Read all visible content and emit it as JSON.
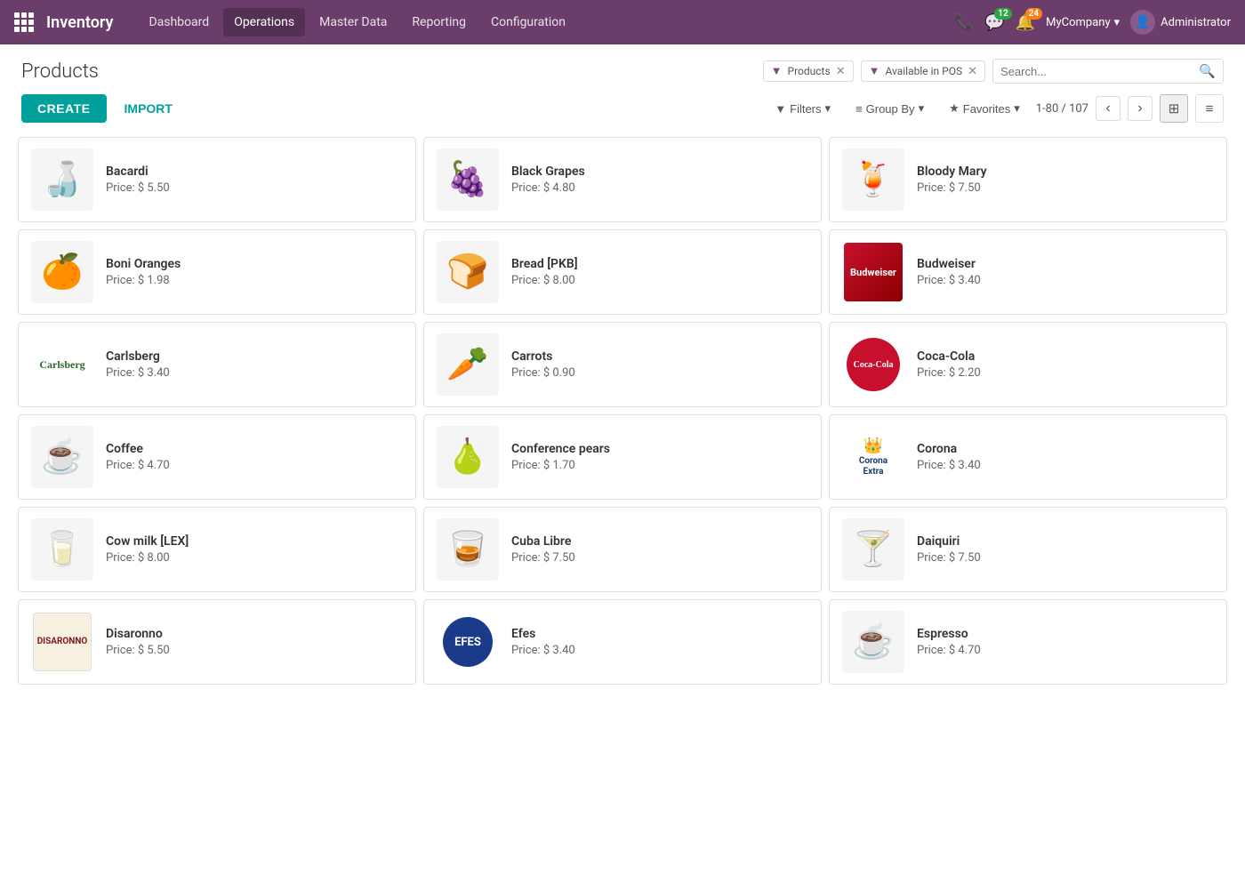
{
  "nav": {
    "brand": "Inventory",
    "links": [
      "Dashboard",
      "Operations",
      "Master Data",
      "Reporting",
      "Configuration"
    ],
    "active_link": "Operations",
    "badge_messages": "12",
    "badge_activity": "24",
    "company": "MyCompany",
    "user": "Administrator"
  },
  "page": {
    "title": "Products"
  },
  "filters": {
    "tag1": "Products",
    "tag2": "Available in POS",
    "search_placeholder": "Search..."
  },
  "toolbar": {
    "create_label": "CREATE",
    "import_label": "IMPORT",
    "filters_label": "Filters",
    "group_by_label": "Group By",
    "favorites_label": "Favorites",
    "pagination": "1-80 / 107"
  },
  "products": [
    {
      "name": "Bacardi",
      "price": "Price: $ 5.50",
      "icon": "🍶"
    },
    {
      "name": "Black Grapes",
      "price": "Price: $ 4.80",
      "icon": "🍇"
    },
    {
      "name": "Bloody Mary",
      "price": "Price: $ 7.50",
      "icon": "🍹"
    },
    {
      "name": "Boni Oranges",
      "price": "Price: $ 1.98",
      "icon": "🍊"
    },
    {
      "name": "Bread [PKB]",
      "price": "Price: $ 8.00",
      "icon": "🍞"
    },
    {
      "name": "Budweiser",
      "price": "Price: $ 3.40",
      "icon": "🍺",
      "brand": "budweiser"
    },
    {
      "name": "Carlsberg",
      "price": "Price: $ 3.40",
      "icon": "🍺",
      "brand": "carlsberg"
    },
    {
      "name": "Carrots",
      "price": "Price: $ 0.90",
      "icon": "🥕"
    },
    {
      "name": "Coca-Cola",
      "price": "Price: $ 2.20",
      "icon": "🥤",
      "brand": "cocacola"
    },
    {
      "name": "Coffee",
      "price": "Price: $ 4.70",
      "icon": "☕"
    },
    {
      "name": "Conference pears",
      "price": "Price: $ 1.70",
      "icon": "🍐"
    },
    {
      "name": "Corona",
      "price": "Price: $ 3.40",
      "icon": "🍺",
      "brand": "corona"
    },
    {
      "name": "Cow milk [LEX]",
      "price": "Price: $ 8.00",
      "icon": "🥛"
    },
    {
      "name": "Cuba Libre",
      "price": "Price: $ 7.50",
      "icon": "🥃"
    },
    {
      "name": "Daiquiri",
      "price": "Price: $ 7.50",
      "icon": "🍸"
    },
    {
      "name": "Disaronno",
      "price": "Price: $ 5.50",
      "icon": "🥃",
      "brand": "disaronno"
    },
    {
      "name": "Efes",
      "price": "Price: $ 3.40",
      "icon": "🍺",
      "brand": "efes"
    },
    {
      "name": "Espresso",
      "price": "Price: $ 4.70",
      "icon": "☕"
    }
  ]
}
